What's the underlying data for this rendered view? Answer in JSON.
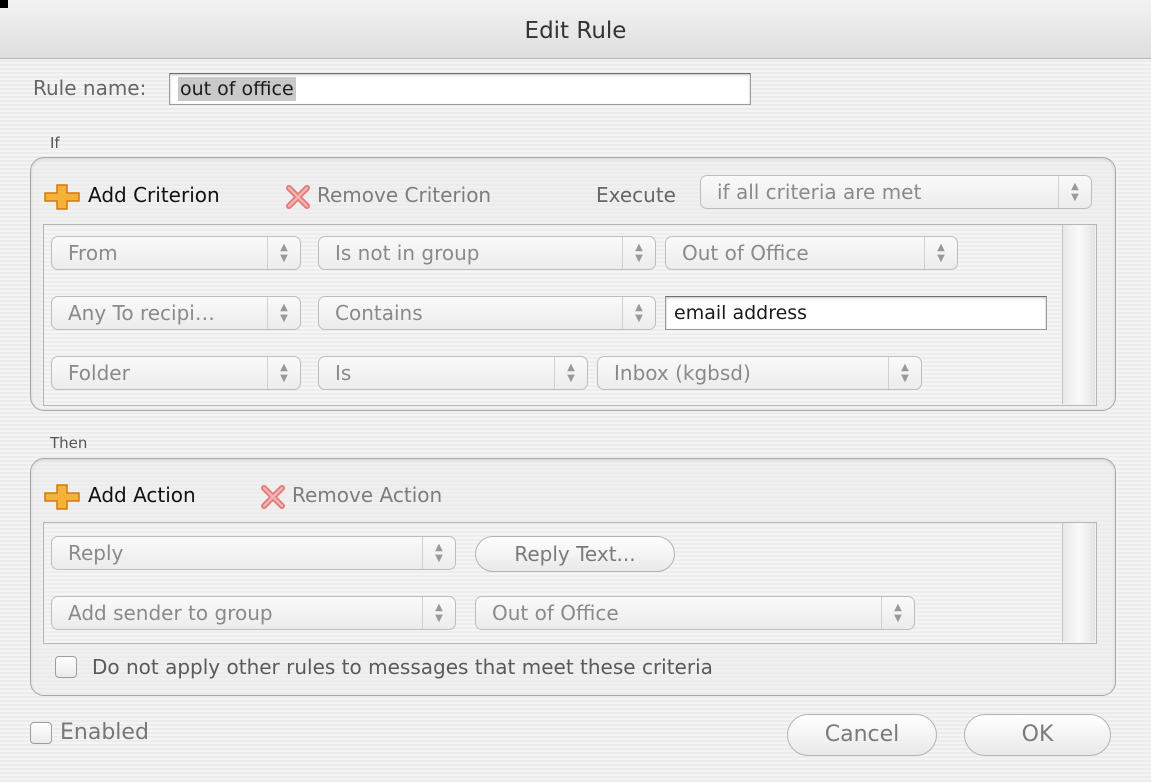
{
  "window": {
    "title": "Edit Rule"
  },
  "rule_name": {
    "label": "Rule name:",
    "value": "out of office"
  },
  "if_section": {
    "heading": "If",
    "add_label": "Add Criterion",
    "remove_label": "Remove Criterion",
    "execute_label": "Execute",
    "execute_value": "if all criteria are met",
    "criteria": [
      {
        "field": "From",
        "operator": "Is not in group",
        "value": "Out of Office"
      },
      {
        "field": "Any To recipi…",
        "operator": "Contains",
        "value": "email address"
      },
      {
        "field": "Folder",
        "operator": "Is",
        "value": "Inbox (kgbsd)"
      }
    ]
  },
  "then_section": {
    "heading": "Then",
    "add_label": "Add Action",
    "remove_label": "Remove Action",
    "actions": [
      {
        "action": "Reply",
        "button": "Reply Text..."
      },
      {
        "action": "Add sender to group",
        "target": "Out of Office"
      }
    ],
    "stop_rules_label": "Do not apply other rules to messages that meet these criteria"
  },
  "footer": {
    "enabled_label": "Enabled",
    "cancel_label": "Cancel",
    "ok_label": "OK"
  },
  "colors": {
    "plus_icon": "#f5a623",
    "remove_icon": "#e88080"
  }
}
